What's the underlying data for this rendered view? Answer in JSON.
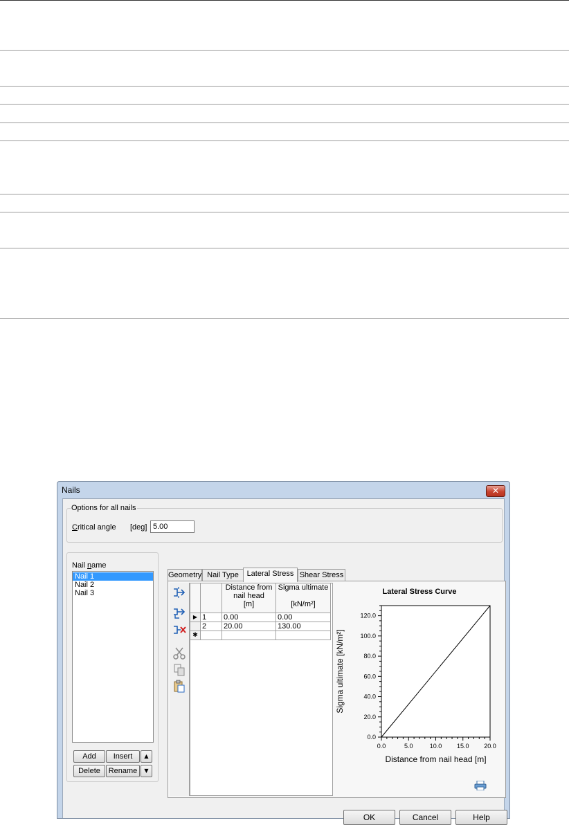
{
  "dialog": {
    "title": "Nails",
    "close_glyph": "✕",
    "options_group": {
      "legend": "Options for all nails",
      "critical_angle_label_underlined": "C",
      "critical_angle_label_rest": "ritical angle",
      "critical_angle_unit": "[deg]",
      "critical_angle_value": "5.00"
    },
    "nail_list": {
      "label_prefix": "Nail ",
      "label_underlined": "n",
      "label_suffix": "ame",
      "items": [
        "Nail 1",
        "Nail 2",
        "Nail 3"
      ],
      "selected_index": 0
    },
    "list_buttons": {
      "add": "Add",
      "insert": "Insert",
      "delete": "Delete",
      "rename": "Rename",
      "up": "▲",
      "down": "▼"
    },
    "tabs": [
      "Geometry",
      "Nail Type",
      "Lateral Stress",
      "Shear Stress"
    ],
    "active_tab": "Lateral Stress",
    "toolbar_icons": [
      "insert-row-icon",
      "append-row-icon",
      "delete-row-icon",
      "cut-icon",
      "copy-icon",
      "paste-icon"
    ],
    "grid": {
      "col1_header_lines": [
        "Distance from",
        "nail head",
        "[m]"
      ],
      "col2_header_lines": [
        "Sigma ultimate",
        "",
        "[kN/m²]"
      ],
      "row_marker": "▶",
      "new_row_marker": "✱",
      "rows": [
        {
          "index": "1",
          "distance": "0.00",
          "sigma": "0.00"
        },
        {
          "index": "2",
          "distance": "20.00",
          "sigma": "130.00"
        }
      ]
    },
    "footer_buttons": {
      "ok": "OK",
      "cancel": "Cancel",
      "help": "Help"
    }
  },
  "chart_data": {
    "type": "line",
    "title": "Lateral Stress Curve",
    "xlabel": "Distance from nail head [m]",
    "ylabel": "Sigma ultimate [kN/m²]",
    "x_ticks": [
      "0.0",
      "5.0",
      "10.0",
      "15.0",
      "20.0"
    ],
    "y_ticks": [
      "0.0",
      "20.0",
      "40.0",
      "60.0",
      "80.0",
      "100.0",
      "120.0"
    ],
    "xlim": [
      0,
      20
    ],
    "ylim": [
      0,
      130
    ],
    "series": [
      {
        "x": [
          0,
          20
        ],
        "y": [
          0,
          130
        ]
      }
    ],
    "grid": false
  }
}
